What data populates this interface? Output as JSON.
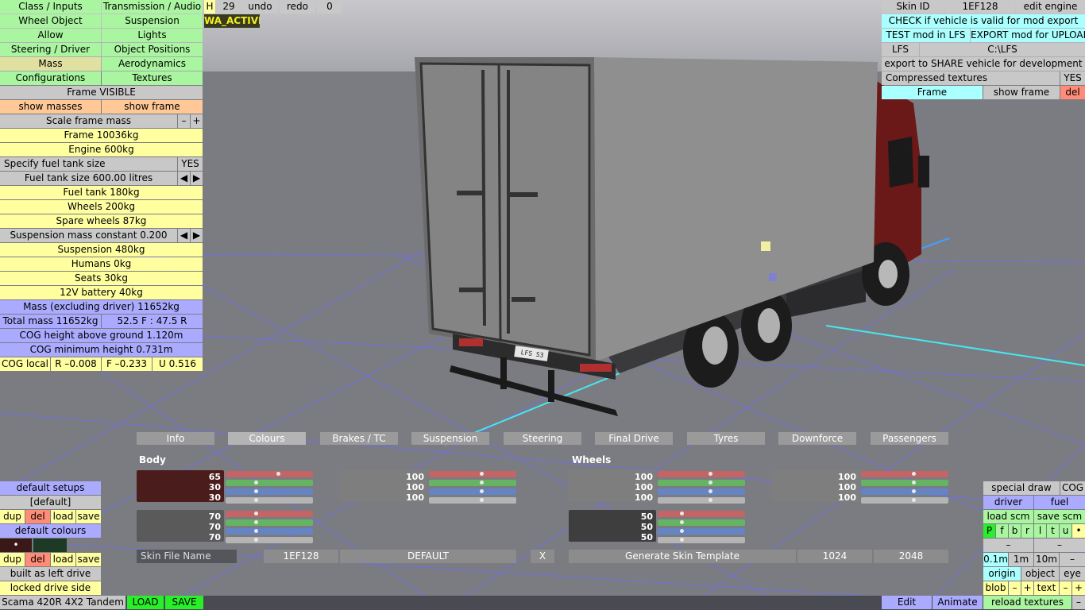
{
  "left_menu": {
    "row1": [
      "Class / Inputs",
      "Transmission / Audio"
    ],
    "row2": [
      "Wheel Object",
      "Suspension"
    ],
    "row3": [
      "Allow",
      "Lights"
    ],
    "row4": [
      "Steering / Driver",
      "Object Positions"
    ],
    "row5": [
      "Mass",
      "Aerodynamics"
    ],
    "row6": [
      "Configurations",
      "Textures"
    ],
    "frame_visible": "Frame VISIBLE",
    "show_masses": "show masses",
    "show_frame": "show frame",
    "scale_frame_mass": "Scale frame mass",
    "minus": "–",
    "plus": "+",
    "frame_mass": "Frame 10036kg",
    "engine_mass": "Engine 600kg",
    "specify_fuel": "Specify fuel tank size",
    "yes": "YES",
    "fuel_tank_size": "Fuel tank size 600.00 litres",
    "left_arrow": "◀",
    "right_arrow": "▶",
    "fuel_tank": "Fuel tank 180kg",
    "wheels": "Wheels 200kg",
    "spare_wheels": "Spare wheels 87kg",
    "susp_const": "Suspension mass constant 0.200",
    "suspension": "Suspension 480kg",
    "humans": "Humans 0kg",
    "seats": "Seats 30kg",
    "battery": "12V battery 40kg",
    "mass_excl": "Mass (excluding driver) 11652kg",
    "total_mass": "Total mass 11652kg",
    "distribution": "52.5 F : 47.5 R",
    "cog_height": "COG height above ground 1.120m",
    "cog_min": "COG minimum height 0.731m",
    "cog_local": "COG local",
    "cog_r": "R –0.008",
    "cog_f": "F –0.233",
    "cog_u": "U 0.516"
  },
  "top_toolbar": {
    "h": "H",
    "num": "29",
    "undo": "undo",
    "redo": "redo",
    "zero": "0",
    "wa_active": "WA_ACTIVE"
  },
  "right_panel": {
    "skin_id": "Skin ID",
    "skin_val": "1EF128",
    "edit_engine": "edit engine",
    "check_valid": "CHECK if vehicle is valid for mod export",
    "test_mod": "TEST mod in LFS",
    "export_mod": "EXPORT mod for UPLOAD",
    "lfs": "LFS",
    "lfs_path": "C:\\LFS",
    "export_share": "export to SHARE vehicle for development",
    "compressed": "Compressed textures",
    "yes": "YES",
    "frame": "Frame",
    "show_frame": "show frame",
    "del": "del"
  },
  "tabs": [
    "Info",
    "Colours",
    "Brakes / TC",
    "Suspension",
    "Steering",
    "Final Drive",
    "Tyres",
    "Downforce",
    "Passengers"
  ],
  "colours": {
    "body_label": "Body",
    "wheels_label": "Wheels",
    "body_main": [
      "65",
      "30",
      "30"
    ],
    "body_main_color": "#4a1c1c",
    "body_second": [
      "100",
      "100",
      "100"
    ],
    "body_third": [
      "70",
      "70",
      "70"
    ],
    "wheels_main": [
      "100",
      "100",
      "100"
    ],
    "wheels_second": [
      "100",
      "100",
      "100"
    ],
    "wheels_third": [
      "50",
      "50",
      "50"
    ]
  },
  "skin_row": {
    "label": "Skin File Name",
    "id": "1EF128",
    "name": "DEFAULT",
    "x": "X",
    "generate": "Generate Skin Template",
    "res1": "1024",
    "res2": "2048"
  },
  "bottom_left": {
    "default_setups": "default setups",
    "default": "[default]",
    "dup": "dup",
    "del": "del",
    "load": "load",
    "save": "save",
    "default_colours": "default colours",
    "bullet": "•",
    "built_left": "built as left drive",
    "locked_side": "locked drive side",
    "vehicle_name": "Scama 420R 4X2 Tandem",
    "load_btn": "LOAD",
    "save_btn": "SAVE"
  },
  "bottom_right": {
    "special_draw": "special draw",
    "cog": "COG",
    "driver": "driver",
    "fuel": "fuel",
    "load_scm": "load scm",
    "save_scm": "save scm",
    "letters": [
      "P",
      "f",
      "b",
      "r",
      "l",
      "t",
      "u",
      "•"
    ],
    "minus": "–",
    "scale1": "0.1m",
    "scale2": "1m",
    "scale3": "10m",
    "origin": "origin",
    "object": "object",
    "eye": "eye",
    "blob": "blob",
    "plus": "+",
    "text": "text",
    "edit": "Edit",
    "animate": "Animate",
    "reload": "reload textures"
  },
  "plate": "LFS S3"
}
